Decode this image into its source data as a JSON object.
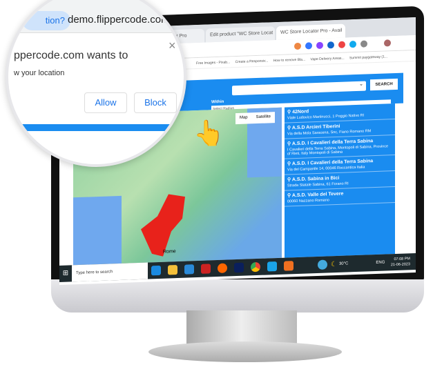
{
  "browser": {
    "tabs": [
      "WC Store Locator Pro",
      "Edit product \"WC Store Locat",
      "WC Store Locator Pro - Avail"
    ],
    "bookmarks": [
      "Free Images - Pixab...",
      "Create a Responsiv...",
      "How to remove Bla...",
      "Vape Delivery Areas...",
      "Summit paygateway (1..."
    ]
  },
  "search": {
    "button": "SEARCH",
    "within_label": "Within",
    "within_value": "Select Radius",
    "select_arrow": "chevron-down-icon"
  },
  "map": {
    "buttons": [
      "Map",
      "Satellite"
    ],
    "city_label": "Rome",
    "pin_color": "#e8221b"
  },
  "stores": [
    {
      "name": "42Nord",
      "address": "Viale Ludovico Martinucci, 1 Poggio Nativo RI"
    },
    {
      "name": "A.S.D Arcieri Tiberini",
      "address": "Via della Mola Saracena, Snc, Fiano Romano RM"
    },
    {
      "name": "A.S.D. I Cavalieri della Terra Sabina",
      "address": "I Cavalieri della Terra Sabina, Montopoli di Sabina, Province of Rieti, Italy Montopoli di Sabina"
    },
    {
      "name": "A.S.D. I Cavalieri della Terra Sabina",
      "address": "Via del Campanile 14, 00046 Roccantica Italia"
    },
    {
      "name": "A.S.D. Sabina in Bici",
      "address": "Strada Statale Sabina, 61 Forano RI"
    },
    {
      "name": "A.S.D. Valle del Tevere",
      "address": "00060 Nazzano Romano"
    }
  ],
  "taskbar": {
    "search_placeholder": "Type here to search",
    "weather": "30°C",
    "lang": "ENG",
    "time": "07:08 PM",
    "date": "21-06-2023"
  },
  "permission_popup": {
    "site_pill": "tion?",
    "url": "demo.flippercode.com/",
    "title": "ppercode.com wants to",
    "subtitle": "w your location",
    "allow": "Allow",
    "block": "Block",
    "close": "×"
  },
  "colors": {
    "accent": "#1a8cf0",
    "link": "#1a73e8"
  }
}
